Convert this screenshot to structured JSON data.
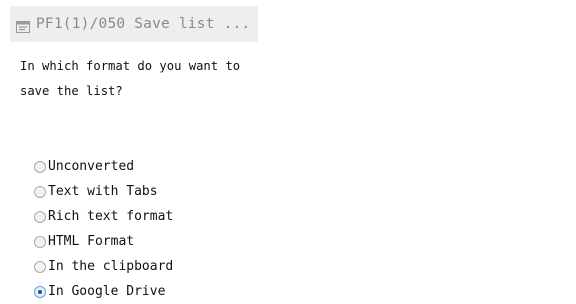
{
  "dialog": {
    "title": "PF1(1)/050 Save list ...",
    "question": "In which format do you want to\nsave the list?",
    "options": [
      {
        "label": "Unconverted",
        "selected": false
      },
      {
        "label": "Text with Tabs",
        "selected": false
      },
      {
        "label": "Rich text format",
        "selected": false
      },
      {
        "label": "HTML Format",
        "selected": false
      },
      {
        "label": "In the clipboard",
        "selected": false
      },
      {
        "label": "In Google Drive",
        "selected": true
      }
    ]
  },
  "colors": {
    "titlebar_bg": "#eeeeee",
    "title_text": "#8a8a8a",
    "radio_selected_dot": "#1d4f8c"
  },
  "icons": {
    "title_icon": "window-list-icon"
  }
}
